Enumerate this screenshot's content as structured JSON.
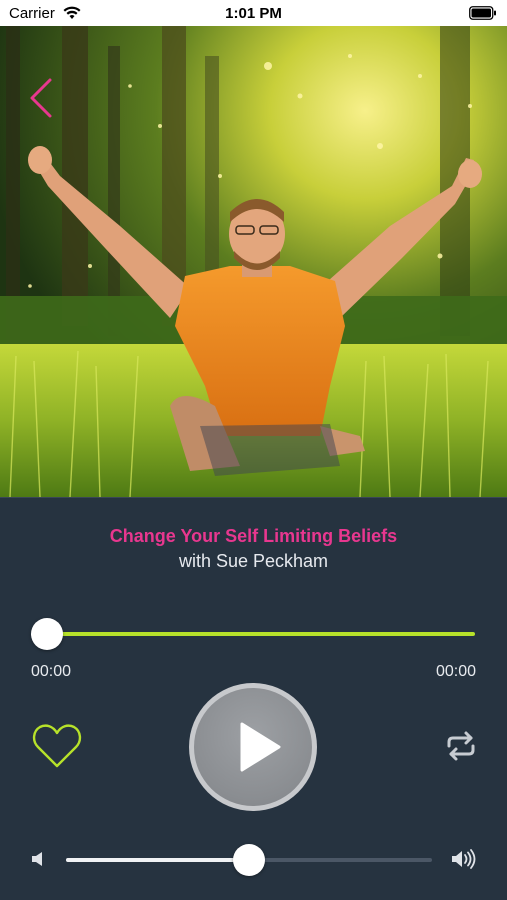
{
  "status_bar": {
    "carrier": "Carrier",
    "time": "1:01 PM",
    "wifi_icon": "wifi-icon",
    "battery_icon": "battery-icon"
  },
  "hero": {
    "image": "man-arms-raised-in-sunlit-grass",
    "back_icon": "chevron-left-icon"
  },
  "track": {
    "title": "Change Your Self Limiting Beliefs",
    "artist": "with Sue Peckham"
  },
  "playback": {
    "elapsed": "00:00",
    "total": "00:00",
    "progress": 0
  },
  "controls": {
    "favorite_icon": "heart-icon",
    "play_icon": "play-icon",
    "repeat_icon": "repeat-icon"
  },
  "volume": {
    "level": 0.5,
    "low_icon": "volume-low-icon",
    "high_icon": "volume-high-icon"
  },
  "colors": {
    "background": "#263340",
    "accent": "#e8378f",
    "progress": "#b7e22a"
  }
}
